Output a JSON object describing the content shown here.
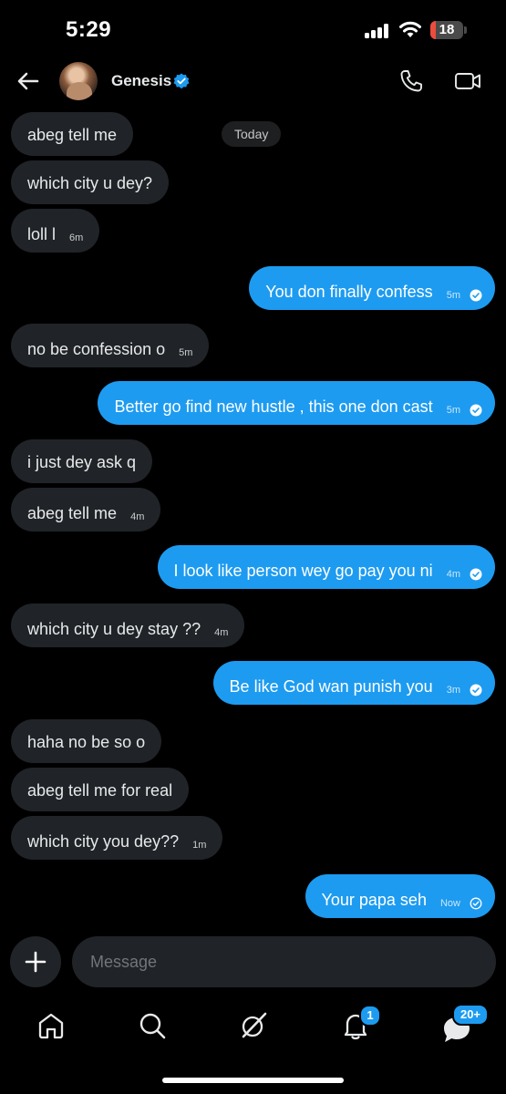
{
  "status_bar": {
    "time": "5:29",
    "battery": "18",
    "battery_level_pct": 18
  },
  "header": {
    "contact_name": "Genesis",
    "verified": true
  },
  "chat": {
    "date_separator": "Today",
    "messages": [
      {
        "direction": "in",
        "text": "abeg tell me",
        "time": ""
      },
      {
        "direction": "in",
        "text": "which city u dey?",
        "time": ""
      },
      {
        "direction": "in",
        "text": "loll l",
        "time": "6m"
      },
      {
        "direction": "out",
        "text": "You don finally confess",
        "time": "5m",
        "status": "read"
      },
      {
        "direction": "in",
        "text": "no be confession o",
        "time": "5m"
      },
      {
        "direction": "out",
        "text": "Better go find new hustle , this one don cast",
        "time": "5m",
        "status": "read"
      },
      {
        "direction": "in",
        "text": "i just dey ask q",
        "time": ""
      },
      {
        "direction": "in",
        "text": "abeg tell me",
        "time": "4m"
      },
      {
        "direction": "out",
        "text": "I look like person wey go pay you ni",
        "time": "4m",
        "status": "read"
      },
      {
        "direction": "in",
        "text": "which city u dey stay ??",
        "time": "4m"
      },
      {
        "direction": "out",
        "text": "Be like God wan punish you",
        "time": "3m",
        "status": "read"
      },
      {
        "direction": "in",
        "text": "haha no be so o",
        "time": ""
      },
      {
        "direction": "in",
        "text": "abeg tell me for real",
        "time": ""
      },
      {
        "direction": "in",
        "text": "which city you dey??",
        "time": "1m"
      },
      {
        "direction": "out",
        "text": "Your papa seh",
        "time": "Now",
        "status": "sent"
      }
    ]
  },
  "composer": {
    "placeholder": "Message"
  },
  "nav": {
    "items": [
      "home-icon",
      "search-icon",
      "grok-icon",
      "notifications-icon",
      "messages-icon"
    ],
    "notifications_badge": "1",
    "messages_badge": "20+"
  },
  "colors": {
    "accent": "#1d9bf0",
    "incoming_bubble": "#202327",
    "background": "#000000"
  }
}
